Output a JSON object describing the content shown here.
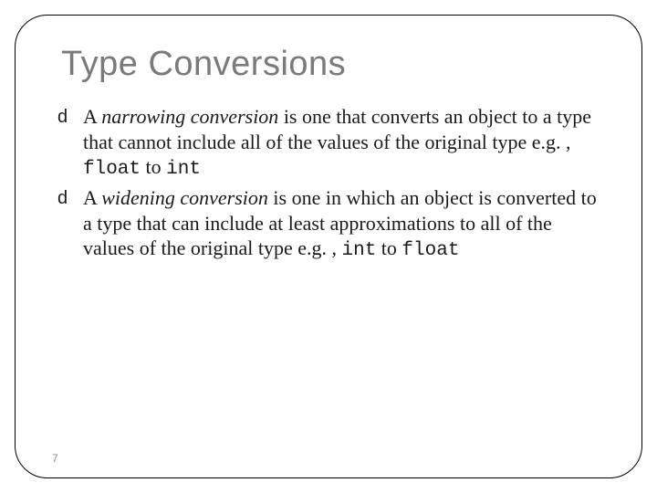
{
  "title": "Type Conversions",
  "bullets": [
    {
      "pre": "A ",
      "term": "narrowing conversion",
      "mid": " is one that converts an object to a type that cannot include all of the values of the original type e.g. , ",
      "code1": "float",
      "joiner": " to ",
      "code2": "int"
    },
    {
      "pre": "A ",
      "term": "widening conversion",
      "mid": " is one in which an object is converted to a type that can include at least approximations to all of the values of the original type e.g. , ",
      "code1": "int",
      "joiner": " to ",
      "code2": "float"
    }
  ],
  "bullet_glyph": "d",
  "page_number": "7"
}
